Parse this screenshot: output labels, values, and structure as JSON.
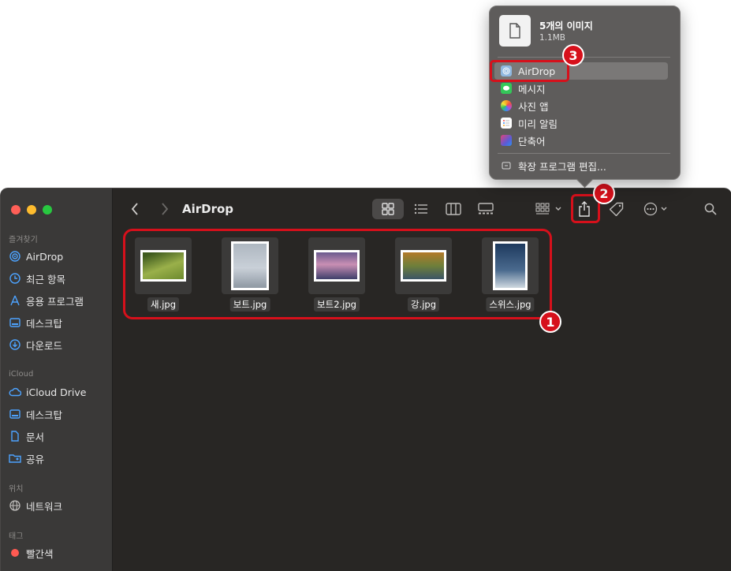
{
  "window": {
    "title": "AirDrop"
  },
  "sidebar": {
    "sections": [
      {
        "label": "즐겨찾기"
      },
      {
        "label": "iCloud"
      },
      {
        "label": "위치"
      },
      {
        "label": "태그"
      }
    ],
    "favorites": [
      {
        "label": "AirDrop",
        "icon": "airdrop-icon"
      },
      {
        "label": "최근 항목",
        "icon": "clock-icon"
      },
      {
        "label": "응용 프로그램",
        "icon": "applications-icon"
      },
      {
        "label": "데스크탑",
        "icon": "desktop-icon"
      },
      {
        "label": "다운로드",
        "icon": "download-icon"
      }
    ],
    "icloud": [
      {
        "label": "iCloud Drive",
        "icon": "cloud-icon"
      },
      {
        "label": "데스크탑",
        "icon": "desktop-icon"
      },
      {
        "label": "문서",
        "icon": "document-icon"
      },
      {
        "label": "공유",
        "icon": "shared-folder-icon"
      }
    ],
    "locations": [
      {
        "label": "네트워크",
        "icon": "network-icon"
      }
    ],
    "tags": [
      {
        "label": "빨간색",
        "color": "#ff5a52"
      }
    ]
  },
  "files": [
    {
      "name": "새.jpg",
      "colors": [
        "#3e5a1e",
        "#9ab04a",
        "#6d8a2e"
      ]
    },
    {
      "name": "보트.jpg",
      "colors": [
        "#c9d0d8",
        "#a9b3bd",
        "#8e98a3"
      ]
    },
    {
      "name": "보트2.jpg",
      "colors": [
        "#6a5a8e",
        "#c98fb4",
        "#3e3f6a"
      ]
    },
    {
      "name": "강.jpg",
      "colors": [
        "#b37a2a",
        "#6e7f3a",
        "#3b5566"
      ]
    },
    {
      "name": "스위스.jpg",
      "colors": [
        "#1e3a5e",
        "#4a6a8e",
        "#cfd8e0"
      ]
    }
  ],
  "share_menu": {
    "title": "5개의 이미지",
    "size": "1.1MB",
    "items": [
      {
        "label": "AirDrop",
        "icon": "airdrop-icon",
        "color": "#8fb8e0",
        "selected": true
      },
      {
        "label": "메시지",
        "icon": "messages-icon",
        "color": "#34c759"
      },
      {
        "label": "사진 앱",
        "icon": "photos-icon",
        "color": "#f5a623"
      },
      {
        "label": "미리 알림",
        "icon": "reminders-icon",
        "color": "#ffffff"
      },
      {
        "label": "단축어",
        "icon": "shortcuts-icon",
        "color": "#5b5bd6"
      }
    ],
    "extensions_label": "확장 프로그램 편집..."
  },
  "annotations": [
    {
      "number": "1"
    },
    {
      "number": "2"
    },
    {
      "number": "3"
    }
  ],
  "colors": {
    "annotation": "#d6101b",
    "accent": "#4da3ff"
  }
}
